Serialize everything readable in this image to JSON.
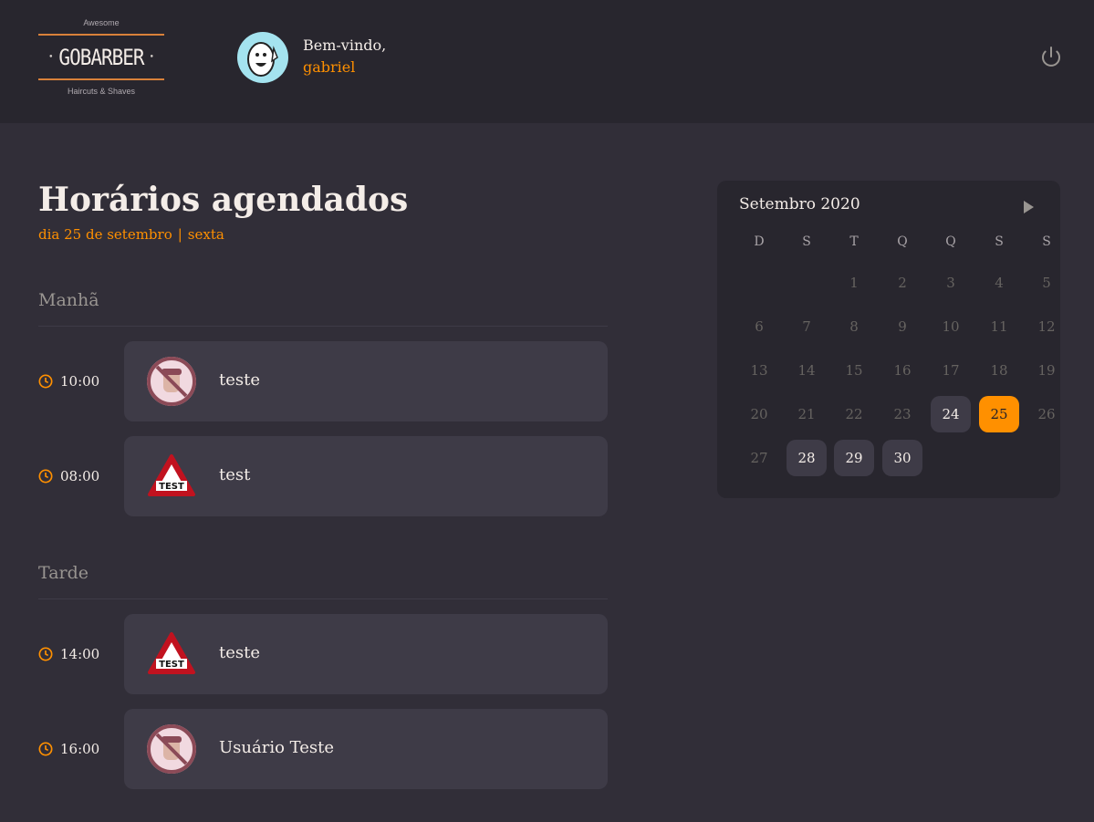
{
  "header": {
    "logo": {
      "top": "Awesome",
      "name": "GOBARBER",
      "bottom": "Haircuts & Shaves"
    },
    "welcome_label": "Bem-vindo,",
    "user_name": "gabriel"
  },
  "page": {
    "title": "Horários agendados",
    "date_label": "dia 25 de setembro",
    "separator": "|",
    "weekday_label": "sexta"
  },
  "morning": {
    "title": "Manhã",
    "appointments": [
      {
        "time": "10:00",
        "client": "teste",
        "avatar": "no-avatar-icon"
      },
      {
        "time": "08:00",
        "client": "test",
        "avatar": "test-sign-icon"
      }
    ]
  },
  "afternoon": {
    "title": "Tarde",
    "appointments": [
      {
        "time": "14:00",
        "client": "teste",
        "avatar": "test-sign-icon"
      },
      {
        "time": "16:00",
        "client": "Usuário Teste",
        "avatar": "no-avatar-icon"
      }
    ]
  },
  "calendar": {
    "month_label": "Setembro 2020",
    "weekdays": [
      "D",
      "S",
      "T",
      "Q",
      "Q",
      "S",
      "S"
    ],
    "first_weekday_index": 2,
    "days_in_month": 30,
    "available_days": [
      24,
      28,
      29,
      30
    ],
    "selected_day": 25
  },
  "colors": {
    "accent": "#ff9000",
    "background": "#312e38",
    "header_background": "#28262e",
    "card_background": "#3e3b47",
    "muted_text": "#999591"
  }
}
